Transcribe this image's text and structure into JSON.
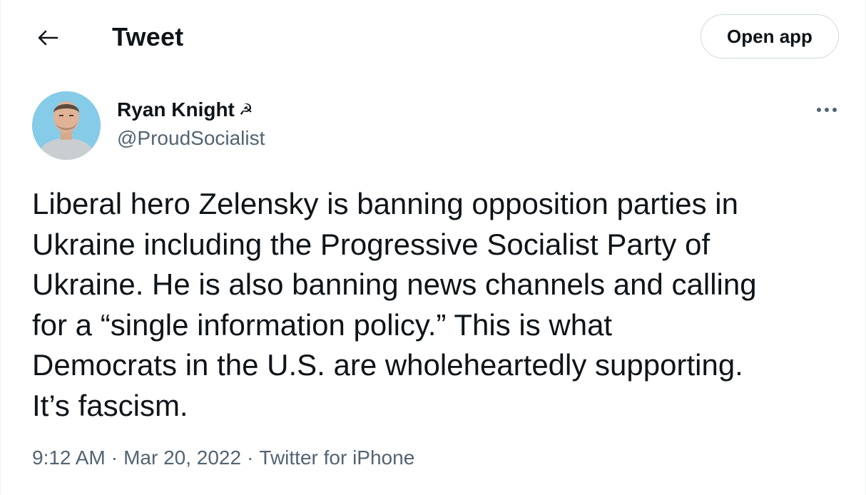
{
  "header": {
    "back_icon": "arrow-left-icon",
    "title": "Tweet",
    "open_app_label": "Open app"
  },
  "tweet": {
    "author": {
      "name": "Ryan Knight",
      "name_emoji": "☭",
      "handle": "@ProudSocialist",
      "avatar_icon": "profile-photo"
    },
    "more_icon": "more-dots-icon",
    "text": "Liberal hero Zelensky is banning opposition parties in\nUkraine including the Progressive Socialist Party of\nUkraine. He is also banning news channels and calling\nfor a “single information policy.” This is what\nDemocrats in the U.S. are wholeheartedly supporting.\nIt’s fascism.",
    "time": "9:12 AM",
    "separator": "·",
    "date": "Mar 20, 2022",
    "source": "Twitter for iPhone"
  },
  "colors": {
    "text_primary": "#0f1419",
    "text_secondary": "#536471",
    "border": "#cfd9de",
    "avatar_bg": "#7fc6e4"
  }
}
